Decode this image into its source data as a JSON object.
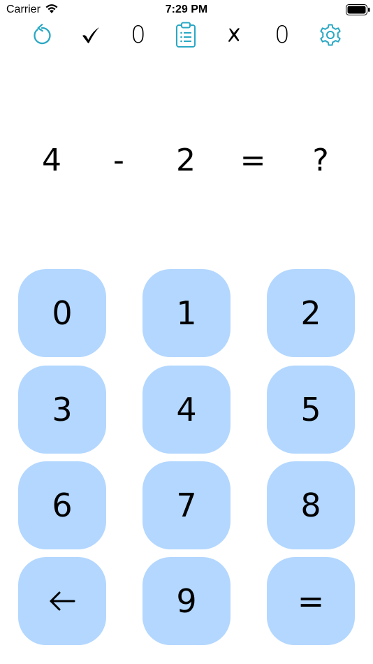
{
  "status_bar": {
    "carrier": "Carrier",
    "time": "7:29 PM"
  },
  "toolbar": {
    "reset_icon": "reset-arrow-icon",
    "correct_icon": "checkmark-icon",
    "correct_count": "0",
    "history_icon": "clipboard-list-icon",
    "wrong_icon": "cross-icon",
    "wrong_count": "0",
    "settings_icon": "gear-icon",
    "accent_color": "#2aa8c4"
  },
  "equation": {
    "left_operand": "4",
    "operator": "-",
    "right_operand": "2",
    "equals": "=",
    "answer": "?"
  },
  "keypad": {
    "key_color": "#b3d7ff",
    "keys": [
      {
        "label": "0"
      },
      {
        "label": "1"
      },
      {
        "label": "2"
      },
      {
        "label": "3"
      },
      {
        "label": "4"
      },
      {
        "label": "5"
      },
      {
        "label": "6"
      },
      {
        "label": "7"
      },
      {
        "label": "8"
      },
      {
        "label": "",
        "icon": "backspace-arrow-icon"
      },
      {
        "label": "9"
      },
      {
        "label": "="
      }
    ]
  }
}
